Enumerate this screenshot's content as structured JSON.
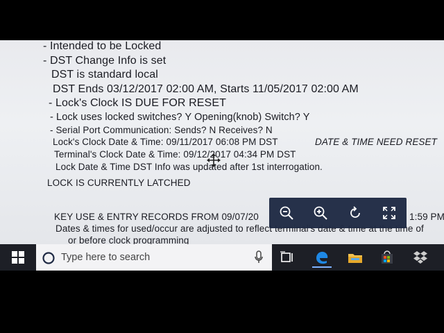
{
  "report": {
    "lines": [
      "- Intended to be Locked",
      "- DST Change Info is set",
      "DST is standard local",
      "DST Ends 03/12/2017 02:00 AM,  Starts 11/05/2017 02:00 AM",
      "- Lock's Clock IS DUE FOR RESET",
      "- Lock uses locked switches? Y    Opening(knob) Switch? Y",
      "- Serial Port Communication:  Sends? N    Receives? N",
      "Lock's Clock Date & Time: 09/11/2017 06:08 PM DST",
      "DATE & TIME NEED RESET",
      "Terminal's Clock Date & Time: 09/12/2017 04:34 PM DST",
      "Lock Date & Time  DST Info was updated after 1st interrogation.",
      "LOCK IS CURRENTLY LATCHED",
      "KEY USE & ENTRY RECORDS FROM 09/07/20",
      "1:59 PM",
      "Dates & times for used/occur are adjusted to reflect terminal's date & time at the time of",
      "or before clock programming"
    ]
  },
  "taskbar": {
    "search_placeholder": "Type here to search"
  },
  "colors": {
    "screen_bg": "#eceef1",
    "text": "#1a1b22",
    "zoombar_bg": "#1f2a44",
    "taskbar_bg": "#1d1f26",
    "edge_blue": "#1e88e5"
  }
}
